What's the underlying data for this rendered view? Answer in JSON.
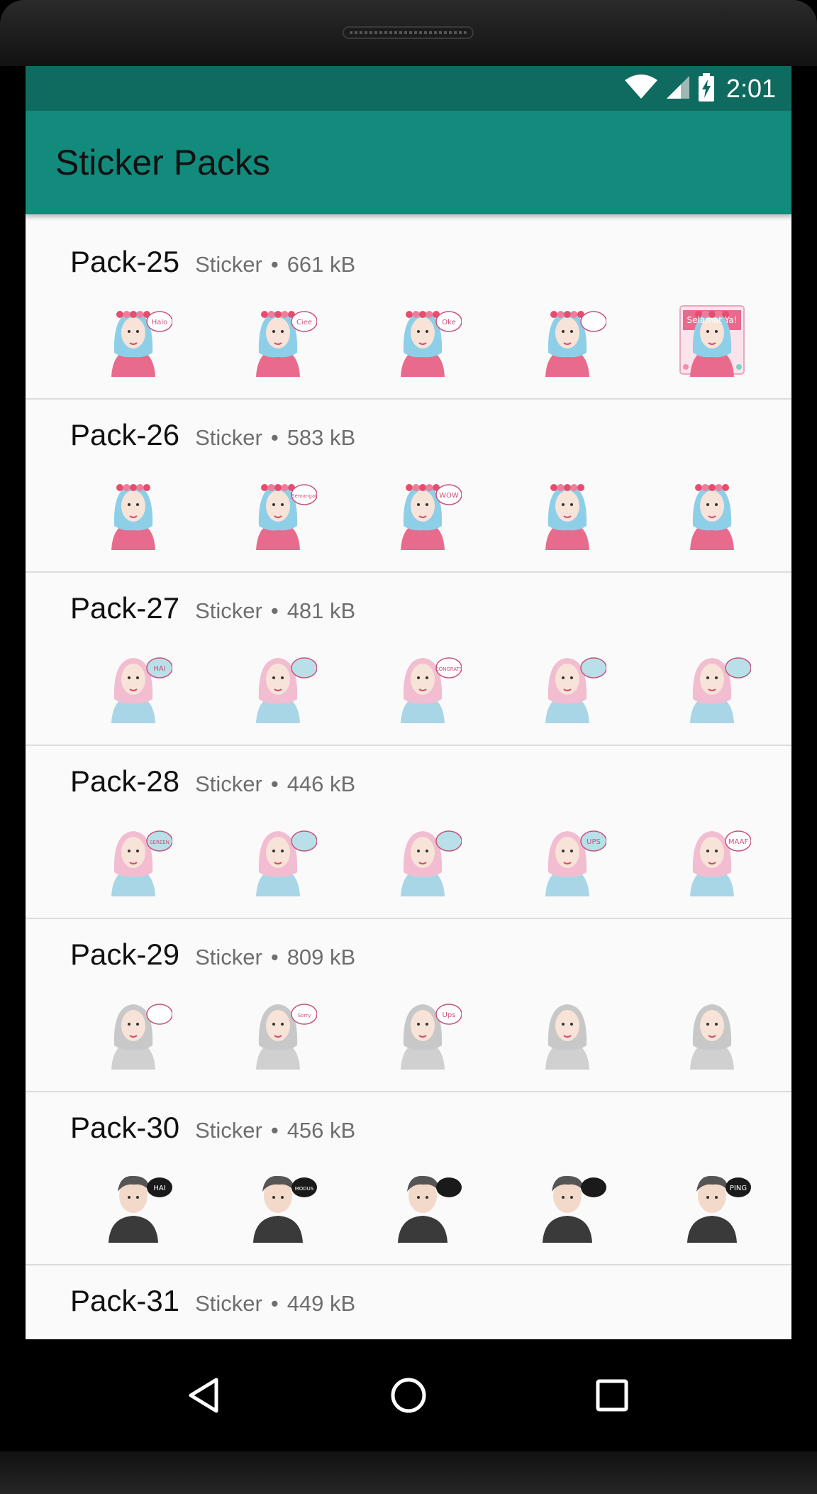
{
  "status_bar": {
    "time": "2:01",
    "icons": [
      "wifi-icon",
      "cell-signal-icon",
      "battery-charging-icon"
    ]
  },
  "app_bar": {
    "title": "Sticker Packs"
  },
  "colors": {
    "status_bar": "#0f6b5f",
    "app_bar": "#128a7c",
    "list_background": "#fafafa"
  },
  "packs": [
    {
      "name": "Pack-25",
      "type": "Sticker",
      "separator": "•",
      "size": "661 kB",
      "stickers": [
        {
          "icon": "hijab-girl-sticker",
          "text": "Halo",
          "hair": "#8ecfe8",
          "top": "#e86a8c",
          "bubble": "#ffffff"
        },
        {
          "icon": "hijab-girl-sticker",
          "text": "Ciee",
          "hair": "#8ecfe8",
          "top": "#e86a8c",
          "bubble": "#ffffff"
        },
        {
          "icon": "hijab-girl-sticker",
          "text": "Oke",
          "hair": "#8ecfe8",
          "top": "#e86a8c",
          "bubble": "#ffffff"
        },
        {
          "icon": "hijab-girl-sticker",
          "text": "",
          "hair": "#8ecfe8",
          "top": "#e86a8c",
          "bubble": "#ffffff"
        },
        {
          "icon": "greeting-card-sticker",
          "text": "Selamat Ya!",
          "hair": "#8ecfe8",
          "top": "#e86a8c",
          "bubble": "#ffffff"
        }
      ]
    },
    {
      "name": "Pack-26",
      "type": "Sticker",
      "separator": "•",
      "size": "583 kB",
      "stickers": [
        {
          "icon": "hijab-girl-sticker",
          "text": "",
          "hair": "#8ecfe8",
          "top": "#e86a8c",
          "bubble": ""
        },
        {
          "icon": "hijab-girl-sticker",
          "text": "Semangat",
          "hair": "#8ecfe8",
          "top": "#e86a8c",
          "bubble": "#ffffff"
        },
        {
          "icon": "hijab-girl-sticker",
          "text": "WOW",
          "hair": "#8ecfe8",
          "top": "#e86a8c",
          "bubble": "#ffffff"
        },
        {
          "icon": "hijab-girl-sticker",
          "text": "",
          "hair": "#8ecfe8",
          "top": "#e86a8c",
          "bubble": ""
        },
        {
          "icon": "hijab-girl-sticker",
          "text": "",
          "hair": "#8ecfe8",
          "top": "#e86a8c",
          "bubble": ""
        }
      ]
    },
    {
      "name": "Pack-27",
      "type": "Sticker",
      "separator": "•",
      "size": "481 kB",
      "stickers": [
        {
          "icon": "hijab-girl-sticker",
          "text": "HAI",
          "hair": "#f2bdd0",
          "top": "#a9d6e6",
          "bubble": "#b9dfe8"
        },
        {
          "icon": "hijab-girl-sticker",
          "text": "",
          "hair": "#f2bdd0",
          "top": "#a9d6e6",
          "bubble": "#b9dfe8"
        },
        {
          "icon": "hijab-girl-sticker",
          "text": "CONGRATS",
          "hair": "#f2bdd0",
          "top": "#a9d6e6",
          "bubble": "#ffffff"
        },
        {
          "icon": "hijab-girl-sticker",
          "text": "",
          "hair": "#f2bdd0",
          "top": "#a9d6e6",
          "bubble": "#b9dfe8"
        },
        {
          "icon": "hijab-girl-sticker",
          "text": "",
          "hair": "#f2bdd0",
          "top": "#a9d6e6",
          "bubble": "#b9dfe8"
        }
      ]
    },
    {
      "name": "Pack-28",
      "type": "Sticker",
      "separator": "•",
      "size": "446 kB",
      "stickers": [
        {
          "icon": "hijab-girl-sticker",
          "text": "SEREEN",
          "hair": "#f2bdd0",
          "top": "#a9d6e6",
          "bubble": "#b9dfe8"
        },
        {
          "icon": "hijab-girl-sticker",
          "text": "",
          "hair": "#f2bdd0",
          "top": "#a9d6e6",
          "bubble": "#b9dfe8"
        },
        {
          "icon": "hijab-girl-sticker",
          "text": "",
          "hair": "#f2bdd0",
          "top": "#a9d6e6",
          "bubble": "#b9dfe8"
        },
        {
          "icon": "hijab-girl-sticker",
          "text": "UPS",
          "hair": "#f2bdd0",
          "top": "#a9d6e6",
          "bubble": "#b9dfe8"
        },
        {
          "icon": "hijab-girl-sticker",
          "text": "MAAF",
          "hair": "#f2bdd0",
          "top": "#a9d6e6",
          "bubble": "#ffffff"
        }
      ]
    },
    {
      "name": "Pack-29",
      "type": "Sticker",
      "separator": "•",
      "size": "809 kB",
      "stickers": [
        {
          "icon": "hijab-girl-sticker",
          "text": "",
          "hair": "#c8c8c8",
          "top": "#d0d0d0",
          "bubble": "#ffffff"
        },
        {
          "icon": "hijab-girl-sticker",
          "text": "Sorry",
          "hair": "#c8c8c8",
          "top": "#d0d0d0",
          "bubble": "#ffffff"
        },
        {
          "icon": "hijab-girl-sticker",
          "text": "Ups",
          "hair": "#c8c8c8",
          "top": "#d0d0d0",
          "bubble": "#ffffff"
        },
        {
          "icon": "hijab-girl-sticker",
          "text": "",
          "hair": "#c8c8c8",
          "top": "#d0d0d0",
          "bubble": ""
        },
        {
          "icon": "hijab-girl-sticker",
          "text": "",
          "hair": "#c8c8c8",
          "top": "#d0d0d0",
          "bubble": ""
        }
      ]
    },
    {
      "name": "Pack-30",
      "type": "Sticker",
      "separator": "•",
      "size": "456 kB",
      "stickers": [
        {
          "icon": "young-man-sticker",
          "text": "HAI",
          "hair": "#555555",
          "top": "#3a3a3a",
          "bubble": "#1a1a1a"
        },
        {
          "icon": "young-man-sticker",
          "text": "MODUS",
          "hair": "#555555",
          "top": "#3a3a3a",
          "bubble": "#1a1a1a"
        },
        {
          "icon": "young-man-sticker",
          "text": "",
          "hair": "#555555",
          "top": "#3a3a3a",
          "bubble": "#1a1a1a"
        },
        {
          "icon": "young-man-sticker",
          "text": "",
          "hair": "#555555",
          "top": "#3a3a3a",
          "bubble": "#1a1a1a"
        },
        {
          "icon": "young-man-sticker",
          "text": "PING",
          "hair": "#555555",
          "top": "#3a3a3a",
          "bubble": "#1a1a1a"
        }
      ]
    },
    {
      "name": "Pack-31",
      "type": "Sticker",
      "separator": "•",
      "size": "449 kB",
      "stickers": []
    }
  ],
  "nav_bar": {
    "buttons": [
      "back-icon",
      "home-icon",
      "recents-icon"
    ]
  }
}
